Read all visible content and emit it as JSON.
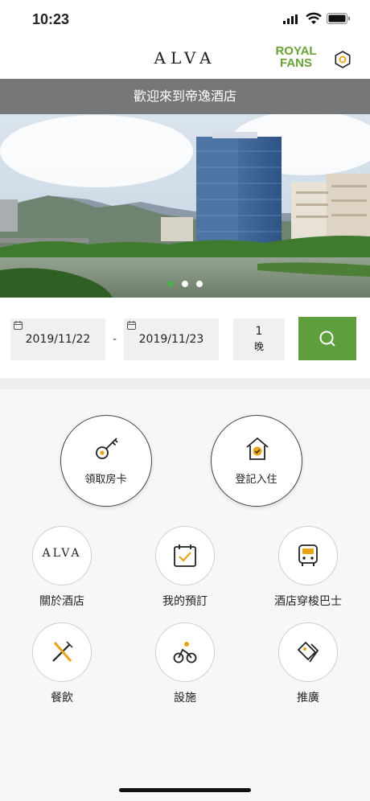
{
  "status_bar": {
    "time": "10:23"
  },
  "header": {
    "logo": "ALVA",
    "royal_line1": "ROYAL",
    "royal_line2": "FANS"
  },
  "hero": {
    "banner": "歡迎來到帝逸酒店"
  },
  "booking": {
    "checkin": "2019/11/22",
    "separator": "-",
    "checkout": "2019/11/23",
    "nights": "1",
    "nights_unit": "晚"
  },
  "quick_actions": {
    "room_key": "領取房卡",
    "check_in": "登記入住"
  },
  "menu": {
    "about_logo": "ALVA",
    "about": "關於酒店",
    "my_booking": "我的預訂",
    "shuttle": "酒店穿梭巴士",
    "dining": "餐飲",
    "facilities": "設施",
    "promotions": "推廣"
  },
  "colors": {
    "accent_green": "#5e9e3c",
    "royal_green": "#6aa135",
    "icon_gold": "#e8a317"
  }
}
